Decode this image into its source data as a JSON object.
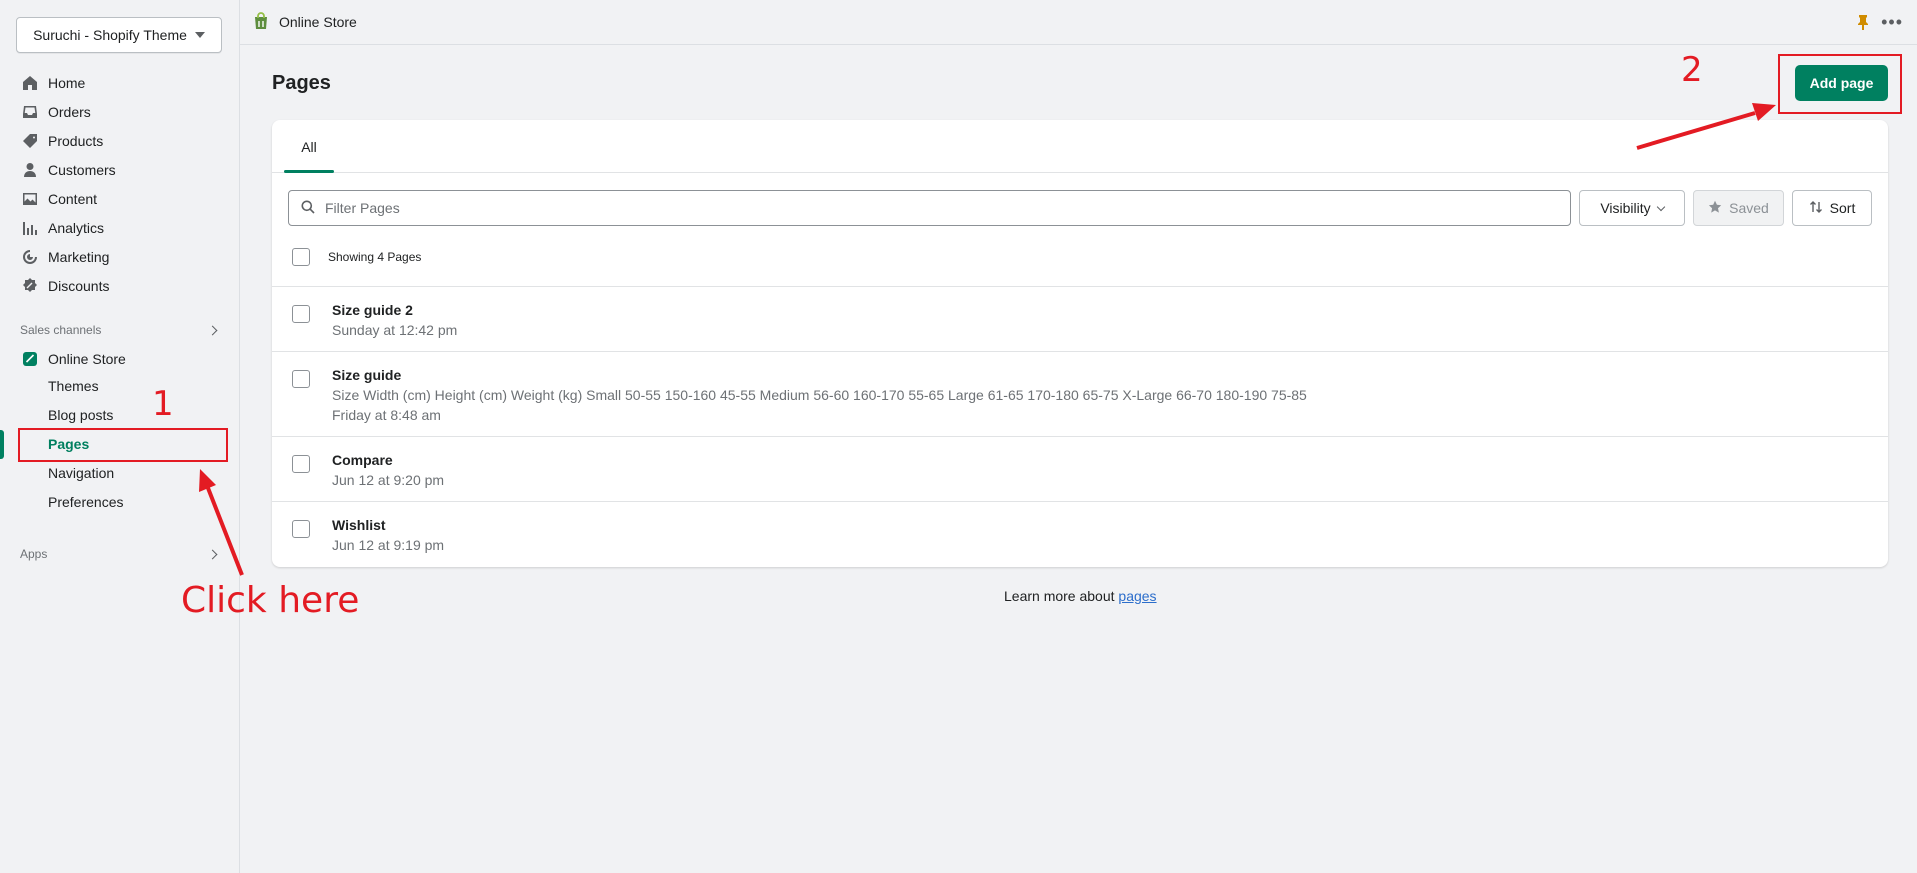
{
  "store": {
    "name": "Suruchi - Shopify Theme"
  },
  "sidebar": {
    "items": [
      {
        "label": "Home",
        "icon": "home-icon"
      },
      {
        "label": "Orders",
        "icon": "inbox-icon"
      },
      {
        "label": "Products",
        "icon": "tag-icon"
      },
      {
        "label": "Customers",
        "icon": "person-icon"
      },
      {
        "label": "Content",
        "icon": "image-icon"
      },
      {
        "label": "Analytics",
        "icon": "chart-icon"
      },
      {
        "label": "Marketing",
        "icon": "target-icon"
      },
      {
        "label": "Discounts",
        "icon": "discount-icon"
      }
    ],
    "sales_channels_label": "Sales channels",
    "online_store": "Online Store",
    "sub_items": [
      "Themes",
      "Blog posts",
      "Pages",
      "Navigation",
      "Preferences"
    ],
    "apps_label": "Apps"
  },
  "topbar": {
    "title": "Online Store"
  },
  "main": {
    "title": "Pages",
    "add_label": "Add page",
    "tab_all": "All",
    "search_placeholder": "Filter Pages",
    "visibility_label": "Visibility",
    "saved_label": "Saved",
    "sort_label": "Sort",
    "showing": "Showing 4 Pages",
    "rows": [
      {
        "title": "Size guide 2",
        "excerpt": "",
        "date": "Sunday at 12:42 pm"
      },
      {
        "title": "Size guide",
        "excerpt": "Size Width (cm) Height (cm) Weight (kg) Small 50-55 150-160 45-55 Medium 56-60 160-170 55-65 Large 61-65 170-180 65-75 X-Large 66-70 180-190 75-85",
        "date": "Friday at 8:48 am"
      },
      {
        "title": "Compare",
        "excerpt": "",
        "date": "Jun 12 at 9:20 pm"
      },
      {
        "title": "Wishlist",
        "excerpt": "",
        "date": "Jun 12 at 9:19 pm"
      }
    ],
    "learn_prefix": "Learn more about ",
    "learn_link": "pages"
  },
  "annotations": {
    "step1": "1",
    "step2": "2",
    "click_here": "Click here",
    "color": "#e31b23"
  },
  "colors": {
    "accent": "#008060",
    "background": "#f1f2f4"
  }
}
